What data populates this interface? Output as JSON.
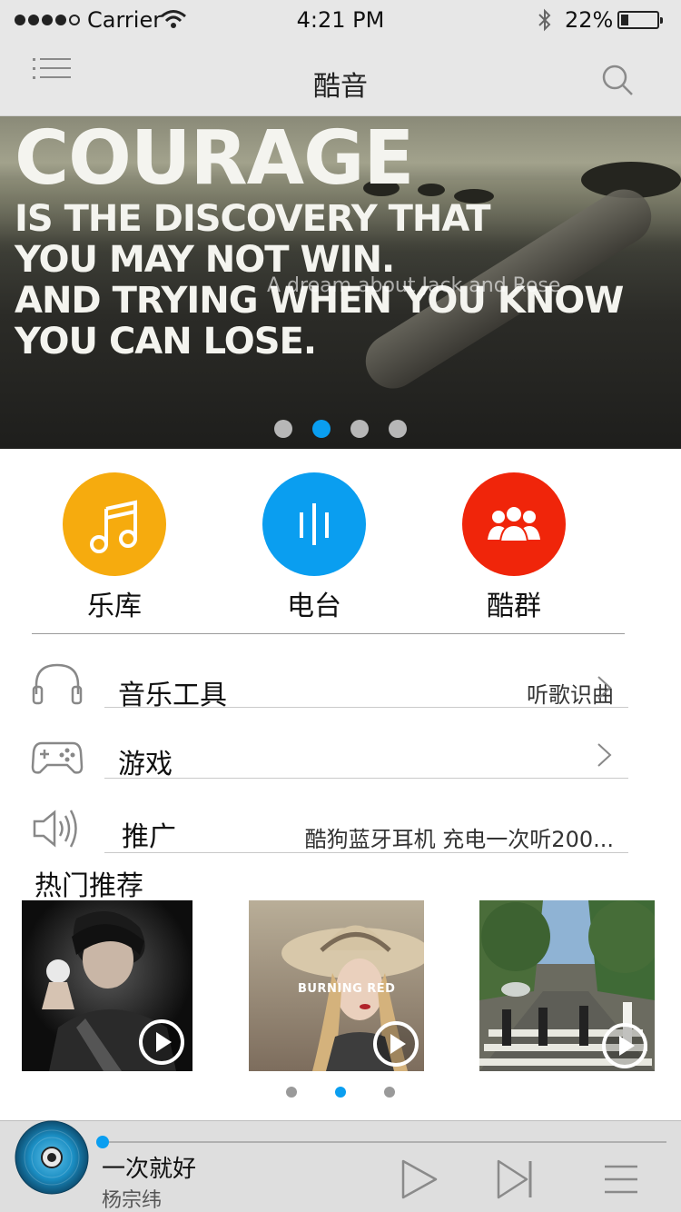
{
  "status_bar": {
    "carrier": "Carrier",
    "time": "4:21 PM",
    "battery_text": "22%",
    "battery_level": 0.22,
    "signal_bars": 4
  },
  "nav": {
    "title": "酷音",
    "menu_icon": "menu-icon",
    "search_icon": "search-icon"
  },
  "banner": {
    "quote": {
      "headline": "COURAGE",
      "lines": [
        "IS THE DISCOVERY THAT",
        "YOU MAY NOT WIN.",
        "AND TRYING WHEN YOU KNOW",
        "YOU CAN LOSE."
      ]
    },
    "caption": "A dream about Jack and Rose",
    "page_count": 4,
    "active_page": 2
  },
  "categories": [
    {
      "label": "乐库",
      "icon": "music-note-icon",
      "color": "#f6ab0e"
    },
    {
      "label": "电台",
      "icon": "radio-bars-icon",
      "color": "#0a9ef0"
    },
    {
      "label": "酷群",
      "icon": "group-icon",
      "color": "#f0250a"
    }
  ],
  "list": [
    {
      "title": "音乐工具",
      "detail": "听歌识曲",
      "icon": "headphones-icon",
      "has_chevron": true
    },
    {
      "title": "游戏",
      "detail": "",
      "icon": "gamepad-icon",
      "has_chevron": true
    },
    {
      "title": "推广",
      "detail": "酷狗蓝牙耳机 充电一次听200...",
      "icon": "speaker-icon",
      "has_chevron": false
    }
  ],
  "recommend": {
    "title": "热门推荐",
    "albums": [
      {
        "name": "album-cover-1",
        "play_icon": "play-icon"
      },
      {
        "name": "album-cover-2",
        "cover_text": "BURNING RED",
        "play_icon": "play-icon"
      },
      {
        "name": "album-cover-3",
        "play_icon": "play-icon"
      }
    ],
    "page_count": 3,
    "active_page": 2
  },
  "player": {
    "song": "一次就好",
    "artist": "杨宗纬",
    "progress": 0.0,
    "accent": "#0a9ef0"
  }
}
